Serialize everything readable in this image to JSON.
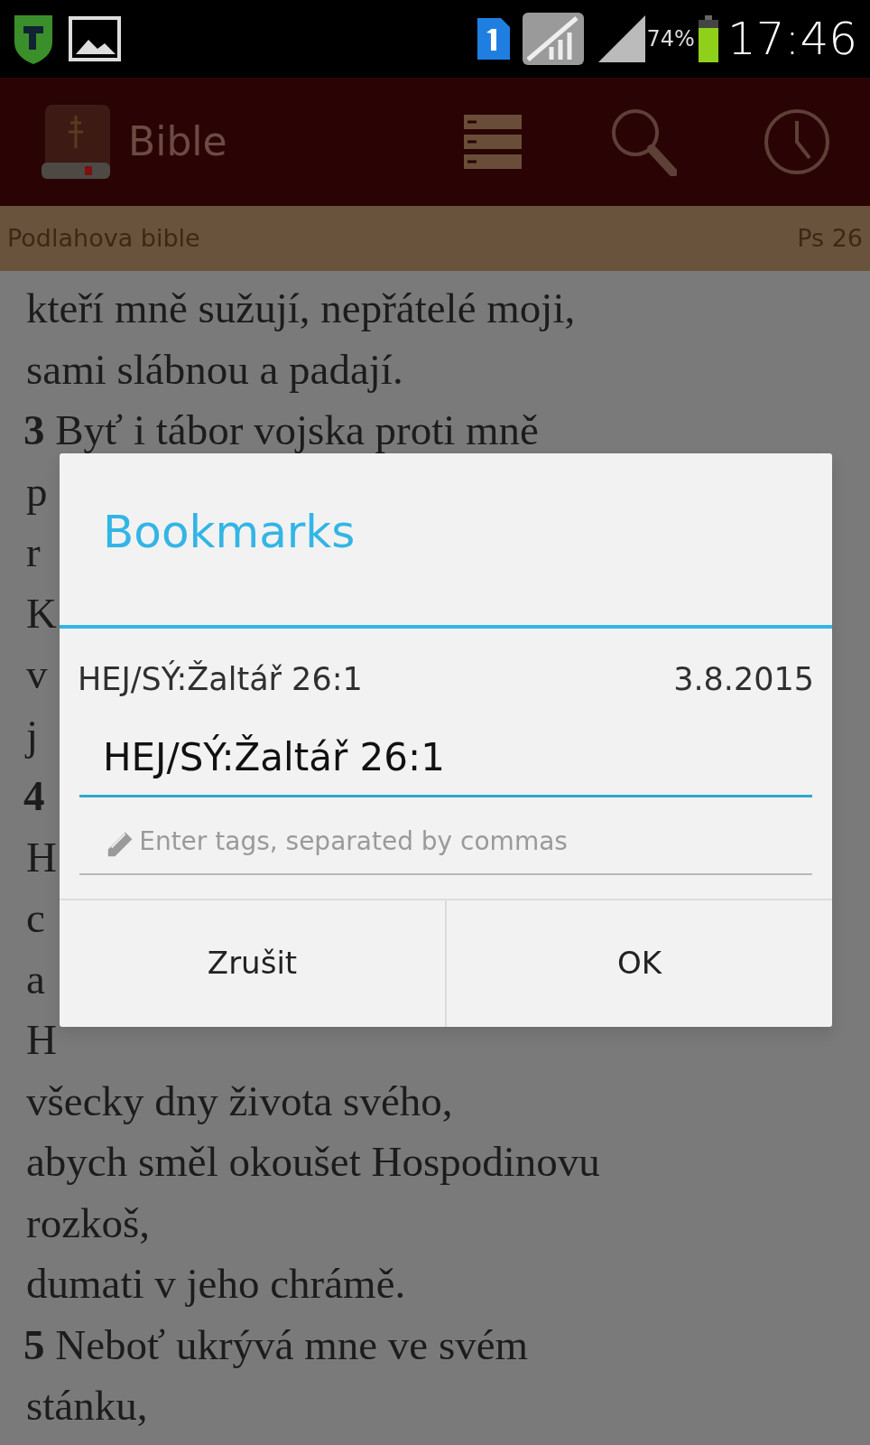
{
  "status_bar": {
    "battery_text": "74%",
    "time": "17:46"
  },
  "app_bar": {
    "title": "Bible"
  },
  "sub_header": {
    "translation": "Podlahova bible",
    "reference": "Ps 26"
  },
  "bible_lines": [
    {
      "text": "kteří mně sužují, nepřátelé moji,"
    },
    {
      "text": "sami slábnou a padají."
    },
    {
      "number": "3",
      "text": "Byť i tábor vojska proti mně"
    },
    {
      "text": "p"
    },
    {
      "text": "r"
    },
    {
      "text": "K"
    },
    {
      "text": "v"
    },
    {
      "text": "j"
    },
    {
      "number": "4"
    },
    {
      "text": "H"
    },
    {
      "text": "c"
    },
    {
      "text": "a"
    },
    {
      "text": "H"
    },
    {
      "text": "všecky dny života svého,"
    },
    {
      "text": "abych směl okoušet Hospodinovu"
    },
    {
      "text": "rozkoš,"
    },
    {
      "text": "dumati v jeho chrámě."
    },
    {
      "number": "5",
      "text": "Neboť ukrývá mne ve svém"
    },
    {
      "text": "stánku,"
    }
  ],
  "dialog": {
    "title": "Bookmarks",
    "reference": "HEJ/SÝ:Žaltář 26:1",
    "date": "3.8.2015",
    "name_field": {
      "value": "HEJ/SÝ:Žaltář 26:1"
    },
    "tags_field": {
      "placeholder": "Enter tags, separated by commas"
    },
    "buttons": [
      "Zrušit",
      "OK"
    ]
  }
}
